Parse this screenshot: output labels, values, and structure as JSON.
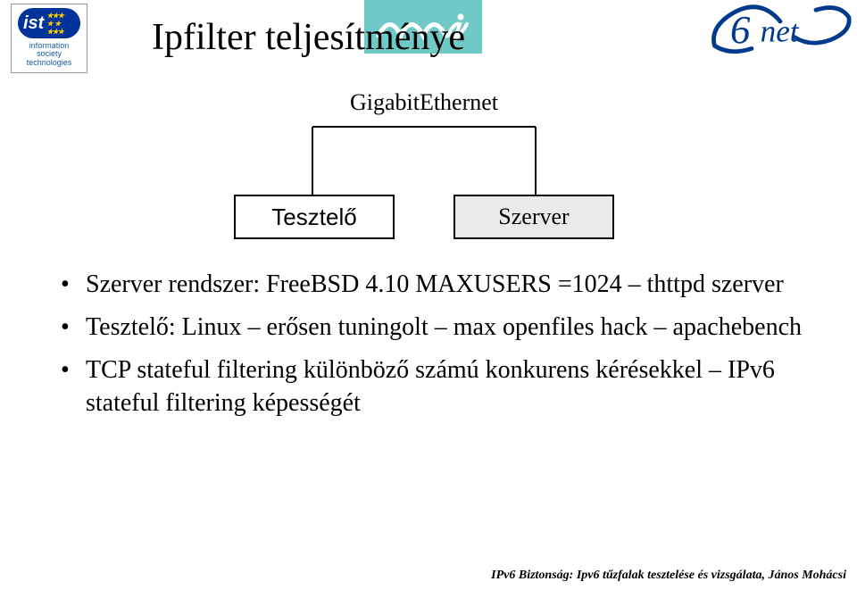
{
  "logos": {
    "ist": {
      "text": "ist",
      "subtext": "information\nsociety\ntechnologies"
    },
    "niif": {
      "text": "niif"
    },
    "sixnet": {
      "digit": "6",
      "text": "net"
    }
  },
  "title": "Ipfilter teljesítménye",
  "diagram": {
    "link_label": "GigabitEthernet",
    "left_box": "Tesztelő",
    "right_box": "Szerver"
  },
  "bullets": [
    {
      "text": "Szerver rendszer: FreeBSD 4.10 MAXUSERS =1024 – thttpd szerver"
    },
    {
      "text": "Tesztelő: Linux – erősen tuningolt – max openfiles hack – apachebench"
    },
    {
      "text": "TCP stateful filtering különböző számú konkurens kérésekkel – IPv6 stateful filtering képességét"
    }
  ],
  "footer": "IPv6 Biztonság: Ipv6 tűzfalak tesztelése és vizsgálata, János Mohácsi"
}
